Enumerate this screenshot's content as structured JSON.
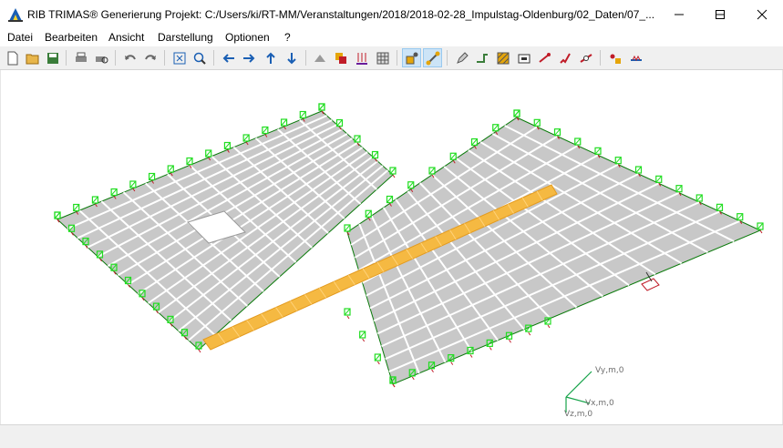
{
  "window": {
    "title": "RIB TRIMAS®  Generierung  Projekt: C:/Users/ki/RT-MM/Veranstaltungen/2018/2018-02-28_Impulstag-Oldenburg/02_Daten/07_...",
    "app_icon": "trimas-logo-icon",
    "buttons": [
      "minimize-icon",
      "maximize-icon",
      "close-icon"
    ]
  },
  "menu": {
    "items": [
      "Datei",
      "Bearbeiten",
      "Ansicht",
      "Darstellung",
      "Optionen",
      "?"
    ]
  },
  "toolbar": {
    "active_tools": [
      "node-select",
      "element-select"
    ]
  },
  "viewport": {
    "model": "slab-mesh",
    "mesh_color": "#c8c8c8",
    "mesh_line_color": "#ffffff",
    "support_color": "#22dd22",
    "highlight_beam_color": "#f5b942",
    "edge_color": "#0a7a0a",
    "axes": {
      "x": "Vx,m,0",
      "y": "Vy,m,0",
      "z": "Vz,m,0"
    }
  },
  "statusbar": {
    "text": ""
  }
}
